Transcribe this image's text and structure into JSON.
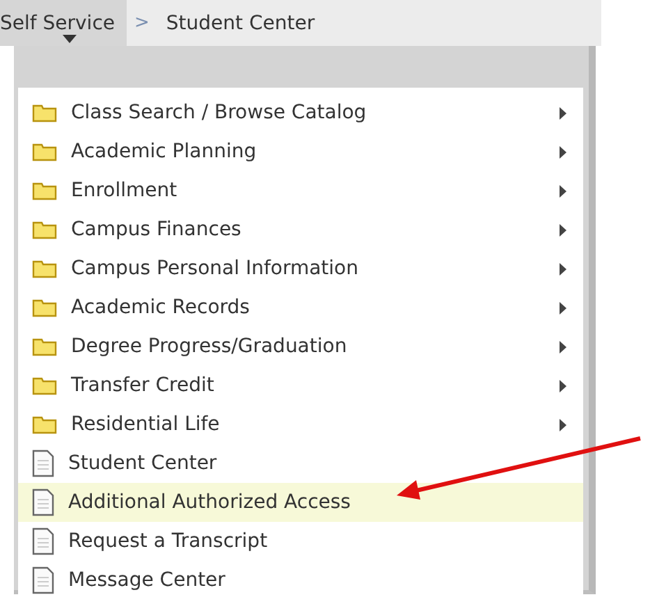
{
  "breadcrumb": [
    {
      "label": "Self Service",
      "selected": true
    },
    {
      "label": "Student Center",
      "selected": false
    }
  ],
  "separator": ">",
  "menu": [
    {
      "label": "Class Search / Browse Catalog",
      "kind": "folder",
      "selected": false
    },
    {
      "label": "Academic Planning",
      "kind": "folder",
      "selected": false
    },
    {
      "label": "Enrollment",
      "kind": "folder",
      "selected": false
    },
    {
      "label": "Campus Finances",
      "kind": "folder",
      "selected": false
    },
    {
      "label": "Campus Personal Information",
      "kind": "folder",
      "selected": false
    },
    {
      "label": "Academic Records",
      "kind": "folder",
      "selected": false
    },
    {
      "label": "Degree Progress/Graduation",
      "kind": "folder",
      "selected": false
    },
    {
      "label": "Transfer Credit",
      "kind": "folder",
      "selected": false
    },
    {
      "label": "Residential Life",
      "kind": "folder",
      "selected": false
    },
    {
      "label": "Student Center",
      "kind": "page",
      "selected": false
    },
    {
      "label": "Additional Authorized Access",
      "kind": "page",
      "selected": true
    },
    {
      "label": "Request a Transcript",
      "kind": "page",
      "selected": false
    },
    {
      "label": "Message Center",
      "kind": "page",
      "selected": false
    }
  ]
}
